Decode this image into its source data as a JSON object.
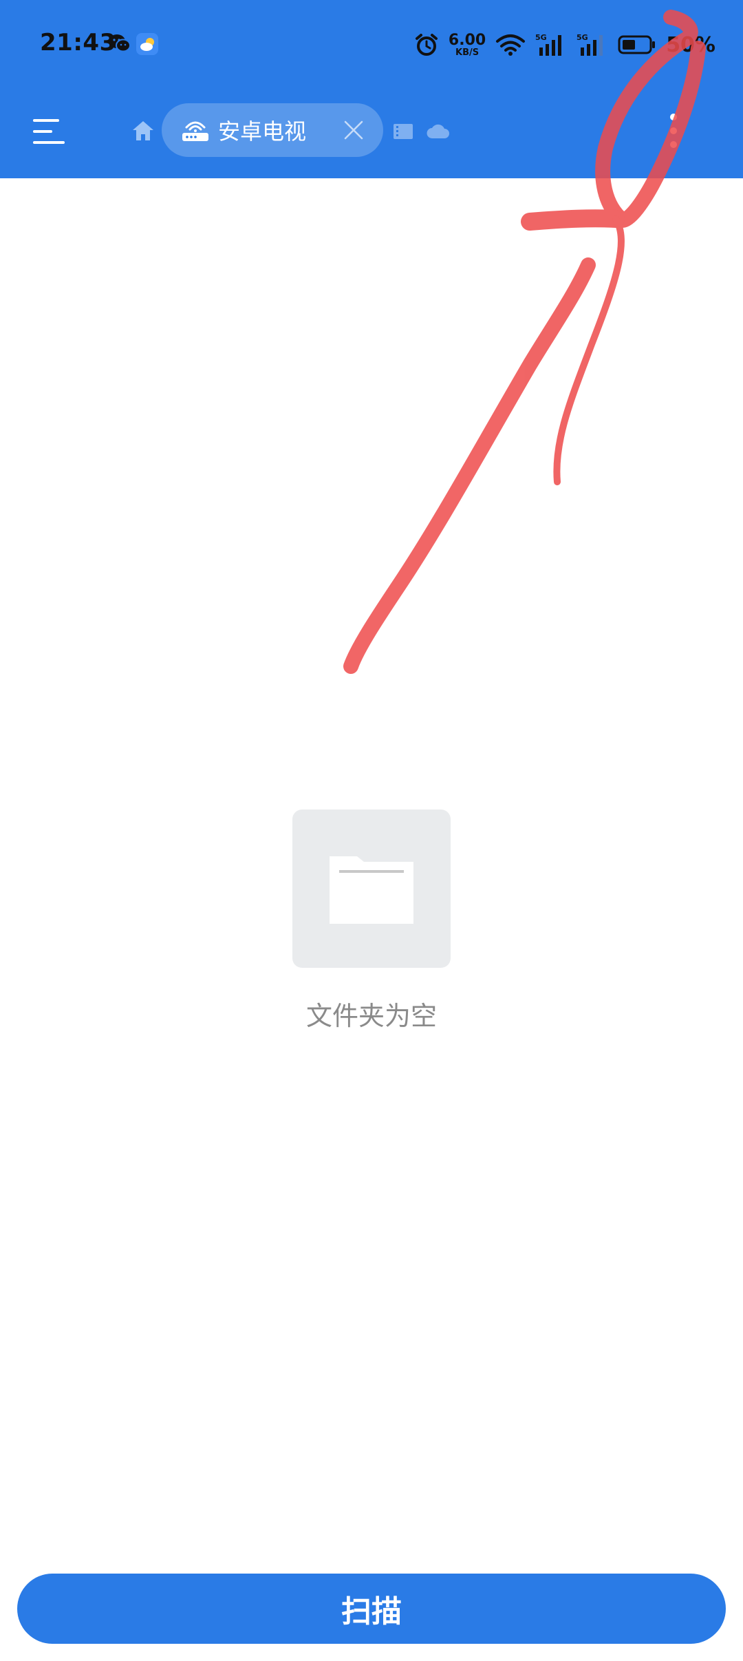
{
  "status_bar": {
    "time": "21:43",
    "network_speed_value": "6.00",
    "network_speed_unit": "KB/S",
    "battery_text": "50%",
    "icons": [
      "wechat-icon",
      "weather-icon",
      "alarm-icon",
      "wifi-icon",
      "signal-5g-icon",
      "signal-5g-icon",
      "battery-icon"
    ]
  },
  "app_bar": {
    "device_chip_label": "安卓电视",
    "icons": [
      "menu-icon",
      "home-icon",
      "router-icon",
      "close-icon",
      "film-icon",
      "cloud-icon",
      "more-vertical-icon"
    ]
  },
  "empty_state": {
    "message": "文件夹为空",
    "icon": "folder-icon"
  },
  "scan_button": {
    "label": "扫描"
  },
  "colors": {
    "primary_blue": "#2a7be6",
    "annotation_red": "#ee4b4b",
    "empty_text": "#8a8a8a",
    "tile_bg": "#e9ebed"
  }
}
